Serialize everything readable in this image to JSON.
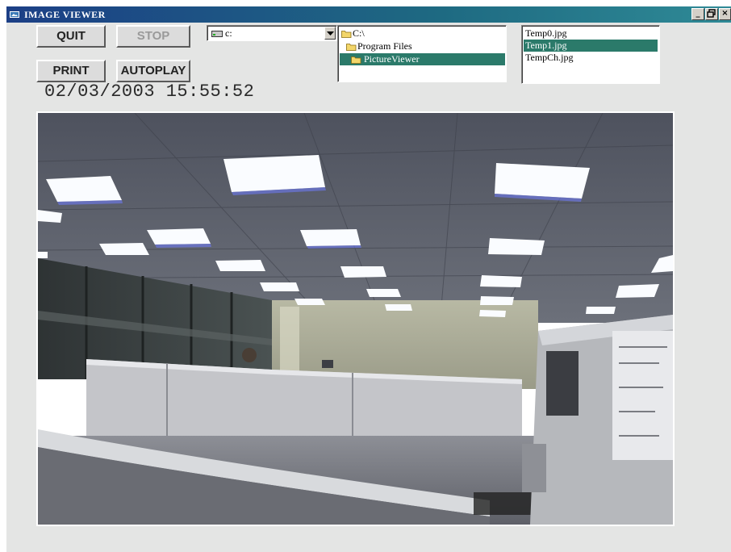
{
  "window": {
    "title": "IMAGE VIEWER",
    "controls": {
      "minimize": "_",
      "restore": "⧉",
      "close": "×"
    }
  },
  "buttons": {
    "quit": "QUIT",
    "stop": "STOP",
    "print": "PRINT",
    "autoplay": "AUTOPLAY"
  },
  "datetime": "02/03/2003 15:55:52",
  "drive_select": {
    "value": "c:",
    "icon": "drive-icon"
  },
  "directories": [
    {
      "label": "C:\\",
      "icon": "open-folder-icon",
      "selected": false
    },
    {
      "label": "Program Files",
      "icon": "open-folder-icon",
      "selected": false
    },
    {
      "label": "PictureViewer",
      "icon": "open-folder-icon",
      "selected": true
    }
  ],
  "files": [
    {
      "label": "Temp0.jpg",
      "selected": false
    },
    {
      "label": "Temp1.jpg",
      "selected": true
    },
    {
      "label": "TempCh.jpg",
      "selected": false
    }
  ],
  "colors": {
    "title_bar": "#1c3f86",
    "selection": "#2b7a6a",
    "window_bg": "#e4e5e4"
  },
  "image": {
    "description_icon": "office-photo"
  }
}
